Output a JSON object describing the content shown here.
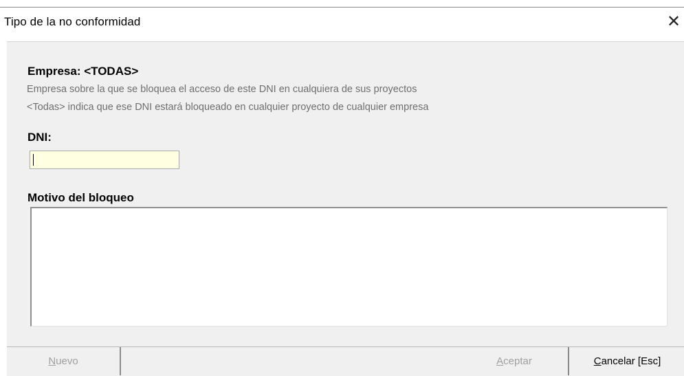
{
  "window": {
    "title": "Tipo de la no conformidad",
    "close_glyph": "✕"
  },
  "form": {
    "empresa_title": "Empresa: <TODAS>",
    "empresa_help_1": "Empresa sobre la que se bloquea el acceso de este DNI en cualquiera de sus proyectos",
    "empresa_help_2": "<Todas> indica que ese DNI estará bloqueado en cualquier proyecto de cualquier empresa",
    "dni_label": "DNI:",
    "dni_value": "",
    "motivo_label": "Motivo del bloqueo",
    "motivo_value": ""
  },
  "footer": {
    "nuevo": {
      "mnemonic": "N",
      "rest": "uevo",
      "enabled": false
    },
    "aceptar": {
      "mnemonic": "A",
      "rest": "ceptar",
      "enabled": false
    },
    "cancelar": {
      "mnemonic": "C",
      "rest": "ancelar [Esc]",
      "enabled": true
    }
  },
  "colors": {
    "dialog_bg": "#f0f0f0",
    "dni_input_bg": "#ffffe1",
    "disabled_text": "#a0a0a0",
    "help_text": "#6e6e6e"
  },
  "icons": {
    "close": "close-icon"
  }
}
